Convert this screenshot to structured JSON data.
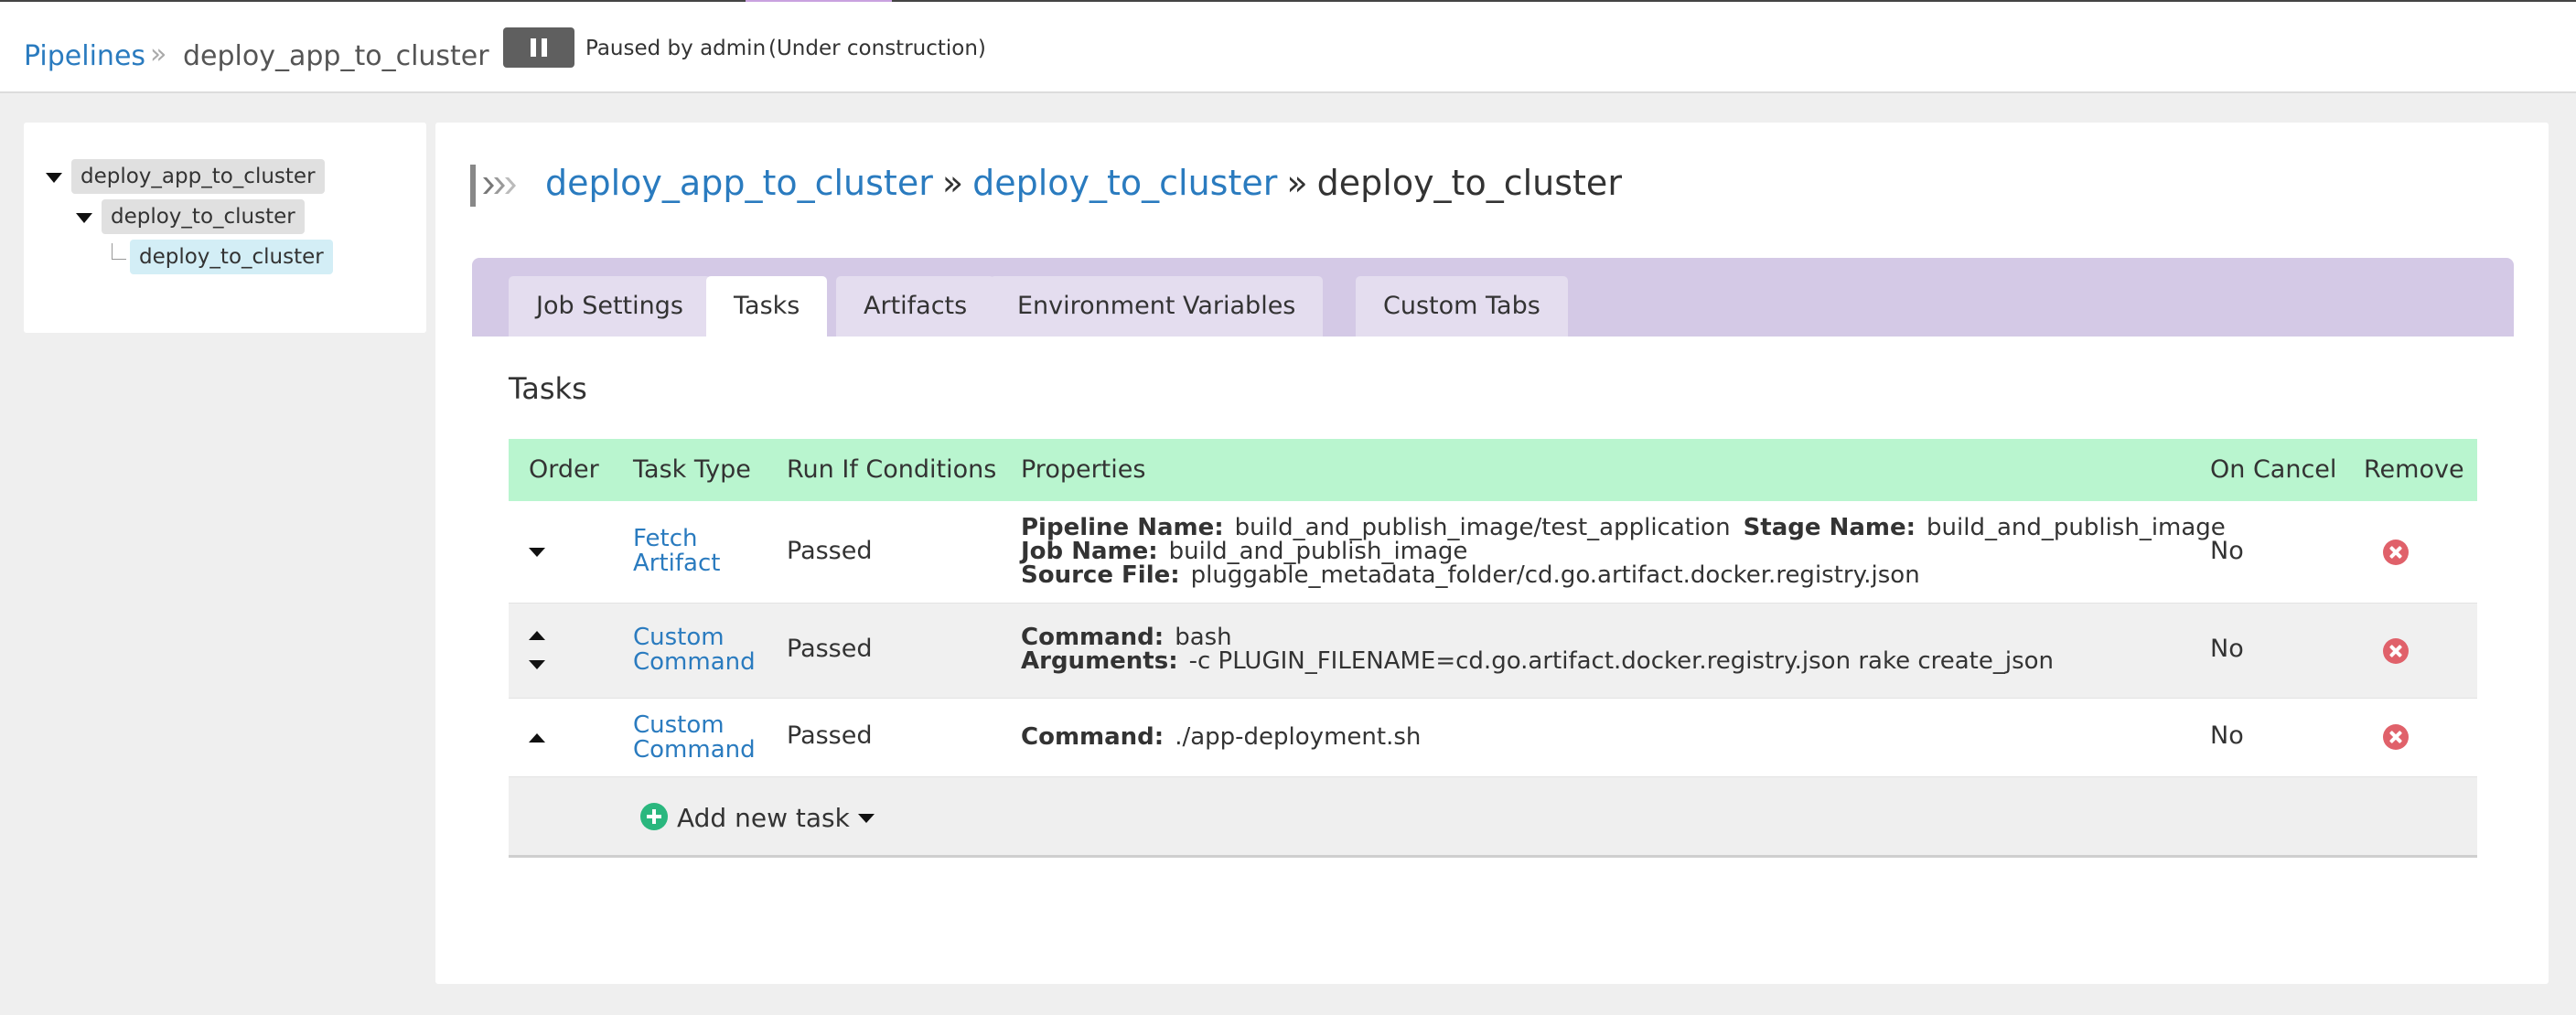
{
  "header": {
    "breadcrumb_root": "Pipelines",
    "breadcrumb_separator": "»",
    "breadcrumb_current": "deploy_app_to_cluster",
    "pause_icon": "pause-icon",
    "paused_text": "Paused by admin",
    "status_text": "(Under construction)"
  },
  "tree": {
    "pipeline": "deploy_app_to_cluster",
    "stage": "deploy_to_cluster",
    "job": "deploy_to_cluster"
  },
  "main": {
    "title": {
      "pipeline": "deploy_app_to_cluster",
      "sep1": "»",
      "stage": "deploy_to_cluster",
      "sep2": "»",
      "job": "deploy_to_cluster"
    },
    "tabs": [
      {
        "label": "Job Settings",
        "active": false
      },
      {
        "label": "Tasks",
        "active": true
      },
      {
        "label": "Artifacts",
        "active": false
      },
      {
        "label": "Environment Variables",
        "active": false
      },
      {
        "label": "Custom Tabs",
        "active": false
      }
    ],
    "section_title": "Tasks",
    "table": {
      "columns": [
        "Order",
        "Task Type",
        "Run If Conditions",
        "Properties",
        "On Cancel",
        "Remove"
      ],
      "rows": [
        {
          "type_line1": "Fetch",
          "type_line2": "Artifact",
          "run_if": "Passed",
          "props": {
            "pipeline_name_label": "Pipeline Name:",
            "pipeline_name": "build_and_publish_image/test_application",
            "stage_name_label": "Stage Name:",
            "stage_name": "build_and_publish_image",
            "job_name_label": "Job Name:",
            "job_name": "build_and_publish_image",
            "source_file_label": "Source File:",
            "source_file": "pluggable_metadata_folder/cd.go.artifact.docker.registry.json"
          },
          "on_cancel": "No"
        },
        {
          "type_line1": "Custom",
          "type_line2": "Command",
          "run_if": "Passed",
          "props": {
            "command_label": "Command:",
            "command": "bash",
            "arguments_label": "Arguments:",
            "arguments": "-c PLUGIN_FILENAME=cd.go.artifact.docker.registry.json rake create_json"
          },
          "on_cancel": "No"
        },
        {
          "type_line1": "Custom",
          "type_line2": "Command",
          "run_if": "Passed",
          "props": {
            "command_label": "Command:",
            "command": "./app-deployment.sh"
          },
          "on_cancel": "No"
        }
      ]
    },
    "add_task_label": "Add new task"
  },
  "colors": {
    "link": "#2a7bbf",
    "tab_strip": "#d4c9e6",
    "table_header": "#b9f5cf",
    "remove_icon": "#e0616a",
    "add_icon": "#2ab77e"
  }
}
